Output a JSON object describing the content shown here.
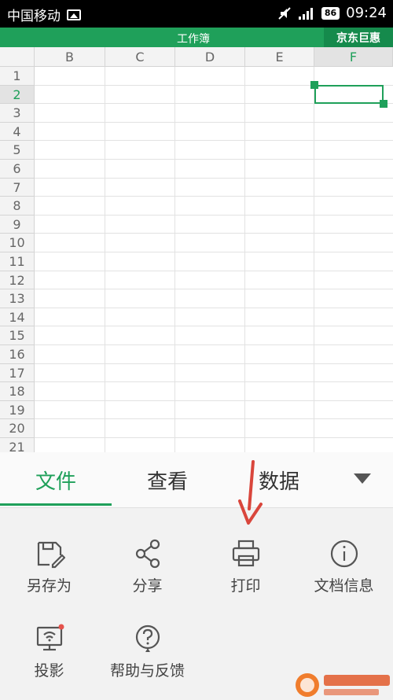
{
  "status_bar": {
    "carrier": "中国移动",
    "battery": "86",
    "time": "09:24"
  },
  "title_bar": {
    "title": "工作簿",
    "jd_button": "京东巨惠"
  },
  "sheet": {
    "columns": [
      "B",
      "C",
      "D",
      "E",
      "F"
    ],
    "rows": [
      "1",
      "2",
      "3",
      "4",
      "5",
      "6",
      "7",
      "8",
      "9",
      "10",
      "11",
      "12",
      "13",
      "14",
      "15",
      "16",
      "17",
      "18",
      "19",
      "20",
      "21"
    ],
    "selected_column": "F",
    "selected_row": "2"
  },
  "tabs": [
    {
      "label": "文件",
      "active": true
    },
    {
      "label": "查看",
      "active": false
    },
    {
      "label": "数据",
      "active": false
    }
  ],
  "file_menu": [
    {
      "label": "另存为",
      "icon": "save-as-icon"
    },
    {
      "label": "分享",
      "icon": "share-icon"
    },
    {
      "label": "打印",
      "icon": "print-icon"
    },
    {
      "label": "文档信息",
      "icon": "info-icon"
    },
    {
      "label": "投影",
      "icon": "projection-icon"
    },
    {
      "label": "帮助与反馈",
      "icon": "help-icon"
    }
  ],
  "colors": {
    "accent": "#1fa05a",
    "arrow": "#d9463c"
  }
}
